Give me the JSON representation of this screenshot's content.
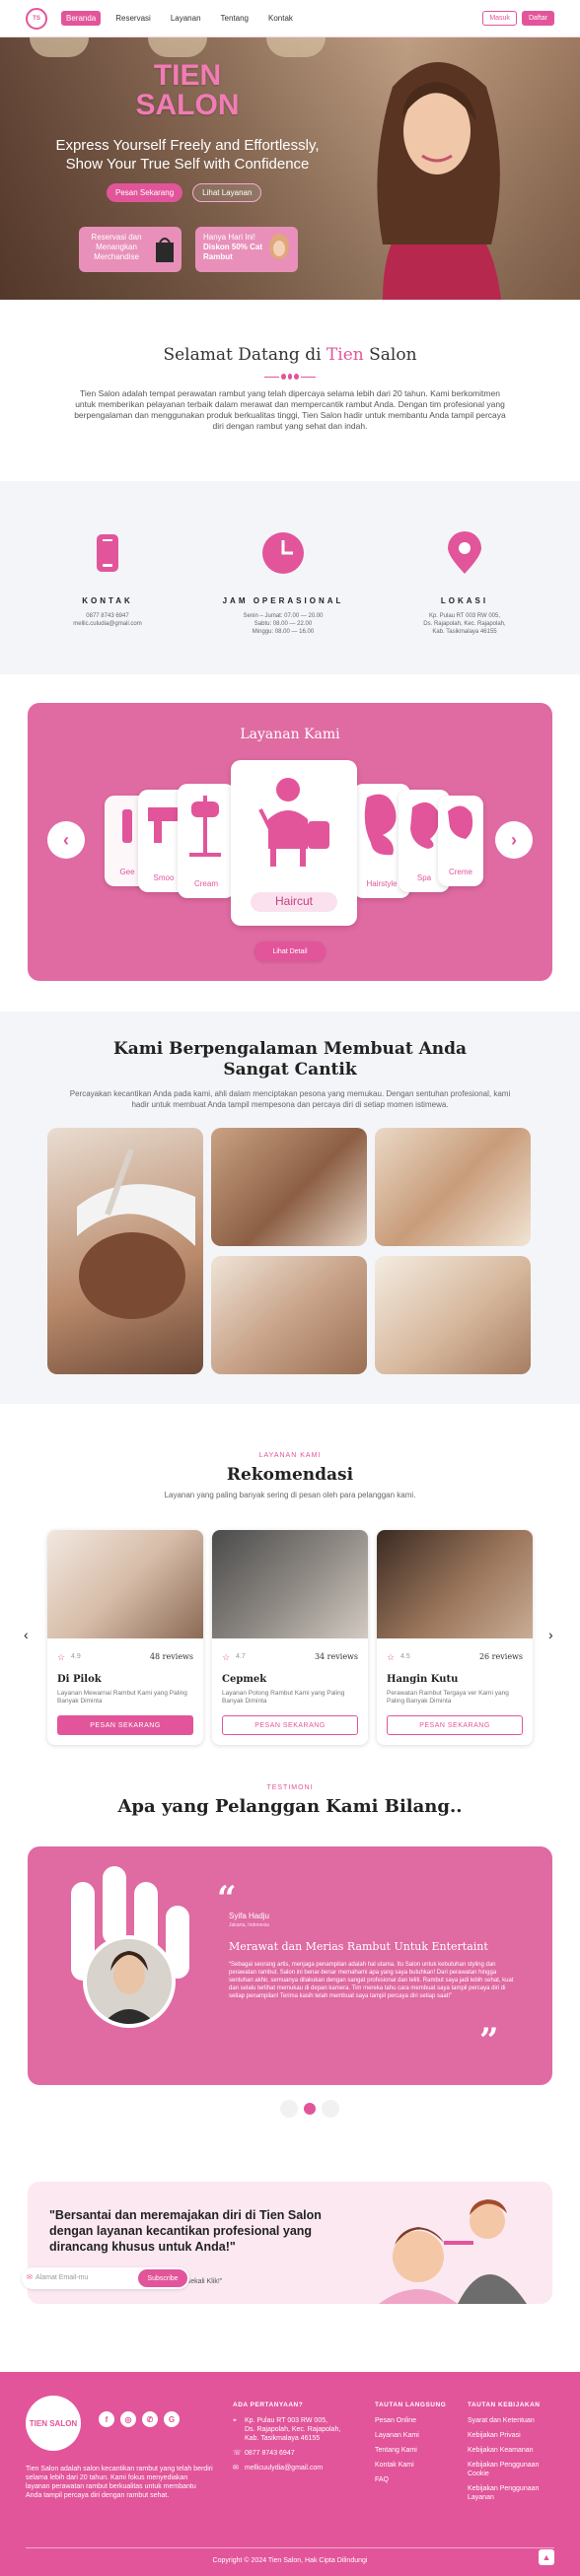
{
  "nav": {
    "logo_text": "TIEN SALON",
    "links": [
      "Beranda",
      "Reservasi",
      "Layanan",
      "Tentang",
      "Kontak"
    ],
    "login": "Masuk",
    "register": "Daftar"
  },
  "hero": {
    "title_line1": "TIEN",
    "title_line2": "SALON",
    "subtitle_line1": "Express Yourself Freely and Effortlessly,",
    "subtitle_line2": "Show Your True Self with Confidence",
    "btn_primary": "Pesan Sekarang",
    "btn_secondary": "Lihat Layanan",
    "promo1": "Reservasi dan Menangkan Merchandise",
    "promo2_line1": "Hanya Hari Ini!",
    "promo2_line2": "Diskon 50% Cat Rambut"
  },
  "welcome": {
    "title_pre": "Selamat Datang di ",
    "title_brand": "Tien",
    "title_post": " Salon",
    "text": "Tien Salon adalah tempat perawatan rambut yang telah dipercaya selama lebih dari 20 tahun. Kami berkomitmen untuk memberikan pelayanan terbaik dalam merawat dan mempercantik rambut Anda. Dengan tim profesional yang berpengalaman dan menggunakan produk berkualitas tinggi, Tien Salon hadir untuk membantu Anda tampil percaya diri dengan rambut yang sehat dan indah."
  },
  "info": {
    "contact_title": "KONTAK",
    "contact_l1": "0877 8743 6947",
    "contact_l2": "mellic.culudia@gmail.com",
    "hours_title": "JAM OPERASIONAL",
    "hours_l1": "Senin – Jumat: 07.00 — 20.00",
    "hours_l2": "Sabtu: 08.00 — 22.00",
    "hours_l3": "Minggu: 08.00 — 16.00",
    "loc_title": "LOKASI",
    "loc_l1": "Kp. Pulau RT 003 RW 005,",
    "loc_l2": "Ds. Rajapolah, Kec. Rajapolah,",
    "loc_l3": "Kab. Tasikmalaya 46155"
  },
  "services": {
    "title": "Layanan Kami",
    "items": [
      "Gee",
      "Smoo",
      "Cream",
      "Haircut",
      "Hairstyle",
      "Spa",
      "Creme"
    ],
    "detail_btn": "Lihat Detail"
  },
  "experience": {
    "title_l1": "Kami Berpengalaman Membuat Anda",
    "title_l2": "Sangat Cantik",
    "text": "Percayakan kecantikan Anda pada kami, ahli dalam menciptakan pesona yang memukau. Dengan sentuhan profesional, kami hadir untuk membuat Anda tampil mempesona dan percaya diri di setiap momen istimewa."
  },
  "recommend": {
    "kicker": "LAYANAN KAMI",
    "title": "Rekomendasi",
    "sub": "Layanan yang paling banyak sering di pesan oleh para pelanggan kami.",
    "cards": [
      {
        "rating": "4.9",
        "reviews": "48 reviews",
        "name": "Di Pilok",
        "desc": "Layanan Mewarnai Rambut Kami yang Paling Banyak Diminta",
        "btn": "PESAN SEKARANG"
      },
      {
        "rating": "4.7",
        "reviews": "34 reviews",
        "name": "Cepmek",
        "desc": "Layanan Potong Rambut Kami yang Paling Banyak Diminta",
        "btn": "PESAN SEKARANG"
      },
      {
        "rating": "4.5",
        "reviews": "26 reviews",
        "name": "Hangin Kutu",
        "desc": "Perawatan Rambut Tergaya ver Kami yang Paling Banyak Diminta",
        "btn": "PESAN SEKARANG"
      }
    ]
  },
  "testimonial": {
    "kicker": "TESTIMONI",
    "title": "Apa yang Pelanggan Kami Bilang..",
    "name": "Syifa Hadju",
    "location": "Jakarta, Indonesia",
    "headline": "Merawat dan Merias Rambut Untuk Entertaint",
    "text": "“Sebagai seorang artis, menjaga penampilan adalah hal utama. Itu Salon untuk kebutuhan styling dan perawatan rambut. Salon ini benar-benar memahami apa yang saya butuhkan! Dari perawatan hingga sentuhan akhir, semuanya dilakukan dengan sangat profesional dan teliti. Rambut saya jadi lebih sehat, kuat dan selalu terlihat memukau di depan kamera. Tim mereka tahu cara membuat saya tampil percaya diri di setiap penampilan! Terima kasih telah membuat saya tampil percaya diri setiap saat!”"
  },
  "newsletter": {
    "quote": "\"Bersantai dan meremajakan diri di Tien Salon dengan layanan kecantikan profesional yang dirancang khusus untuk Anda!\"",
    "sub_l1": "\"Glow Smart, Glow Easy with Tien Salon –",
    "sub_l2": "Perjalanan Kecantikan Anda Hanya Dengan Sekali Klik!\"",
    "placeholder": "Alamat Email-mu",
    "button": "Subscribe"
  },
  "footer": {
    "logo": "TIEN SALON",
    "desc": "Tien Salon adalah salon kecantikan rambut yang telah berdiri selama lebih dari 20 tahun. Kami fokus menyediakan layanan perawatan rambut berkualitas untuk membantu Anda tampil percaya diri dengan rambut sehat.",
    "contact_h": "ADA PERTANYAAN?",
    "addr_l1": "Kp. Pulau RT 003 RW 005,",
    "addr_l2": "Ds. Rajapolah, Kec. Rajapolah,",
    "addr_l3": "Kab. Tasikmalaya 46155",
    "phone": "0877 8743 6947",
    "email": "mellicuulydia@gmail.com",
    "links_h": "TAUTAN LANGSUNG",
    "links": [
      "Pesan Online",
      "Layanan Kami",
      "Tentang Kami",
      "Kontak Kami",
      "FAQ"
    ],
    "policy_h": "TAUTAN KEBIJAKAN",
    "policies": [
      "Syarat dan Ketentuan",
      "Kebijakan Privasi",
      "Kebijakan Keamanan",
      "Kebijakan Penggunaan Cookie",
      "Kebijakan Penggunaan Layanan"
    ],
    "copy": "Copyright © 2024 Tien Salon, Hak Cipta Dilindungi"
  },
  "colors": {
    "brand": "#e2559a",
    "light_pink": "#fce8f1",
    "info_bg": "#f4f5f8"
  }
}
